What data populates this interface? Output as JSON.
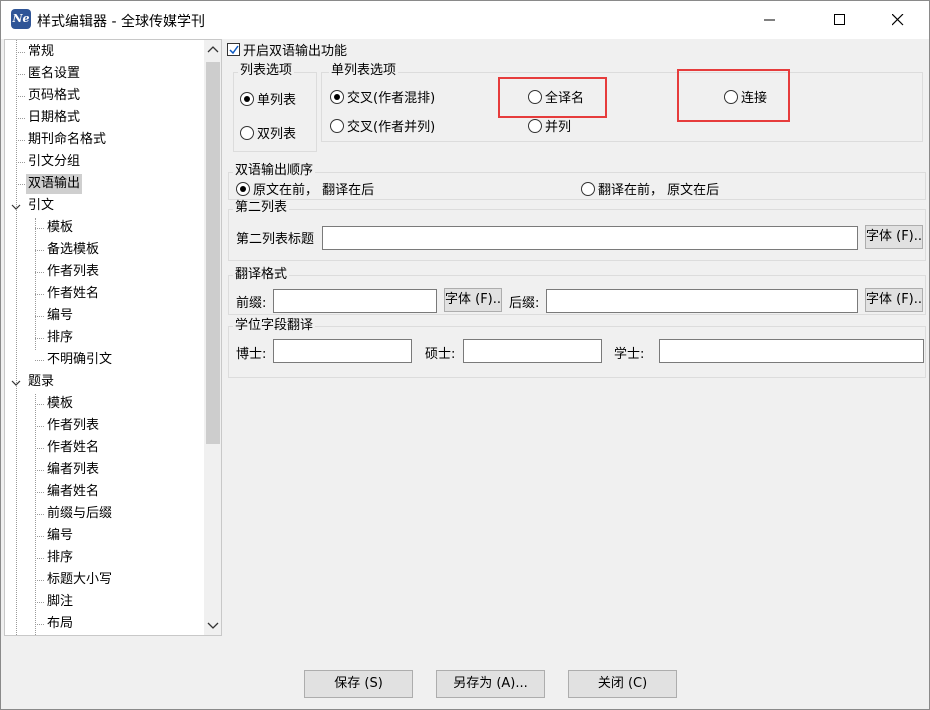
{
  "window": {
    "title": "样式编辑器 - 全球传媒学刊",
    "app_icon_text": "Ne"
  },
  "tree": {
    "items": [
      {
        "label": "常规"
      },
      {
        "label": "匿名设置"
      },
      {
        "label": "页码格式"
      },
      {
        "label": "日期格式"
      },
      {
        "label": "期刊命名格式"
      },
      {
        "label": "引文分组"
      },
      {
        "label": "双语输出",
        "selected": true
      },
      {
        "label": "引文",
        "expanded": true
      },
      {
        "label": "模板"
      },
      {
        "label": "备选模板"
      },
      {
        "label": "作者列表"
      },
      {
        "label": "作者姓名"
      },
      {
        "label": "编号"
      },
      {
        "label": "排序"
      },
      {
        "label": "不明确引文"
      },
      {
        "label": "题录",
        "expanded": true
      },
      {
        "label": "模板"
      },
      {
        "label": "作者列表"
      },
      {
        "label": "作者姓名"
      },
      {
        "label": "编者列表"
      },
      {
        "label": "编者姓名"
      },
      {
        "label": "前缀与后缀"
      },
      {
        "label": "编号"
      },
      {
        "label": "排序"
      },
      {
        "label": "标题大小写"
      },
      {
        "label": "脚注"
      },
      {
        "label": "布局"
      }
    ]
  },
  "bilingual": {
    "enable_label": "开启双语输出功能",
    "enable_checked": true,
    "list_options": {
      "legend": "列表选项",
      "single": "单列表",
      "double": "双列表",
      "selected": "single"
    },
    "single_list_options": {
      "legend": "单列表选项",
      "cross_mixed": "交叉(作者混排)",
      "cross_parallel": "交叉(作者并列)",
      "full_translated": "全译名",
      "parallel": "并列",
      "connect": "连接",
      "selected": "cross_mixed"
    },
    "order": {
      "legend": "双语输出顺序",
      "original_first": "原文在前， 翻译在后",
      "translation_first": "翻译在前， 原文在后",
      "selected": "original_first"
    },
    "second_list": {
      "legend": "第二列表",
      "title_label": "第二列表标题",
      "title_value": "",
      "font_button": "字体 (F)..",
      "font_mnemonic": "F"
    },
    "translation_format": {
      "legend": "翻译格式",
      "prefix_label": "前缀:",
      "prefix_value": "",
      "prefix_font_button": "字体 (F)..",
      "suffix_label": "后缀:",
      "suffix_value": "",
      "suffix_font_button": "字体 (F).."
    },
    "degree_translation": {
      "legend": "学位字段翻译",
      "phd_label": "博士:",
      "phd_value": "",
      "master_label": "硕士:",
      "master_value": "",
      "bachelor_label": "学士:",
      "bachelor_value": ""
    }
  },
  "footer": {
    "save": "保存 (S)",
    "save_as": "另存为 (A)...",
    "close": "关闭 (C)"
  },
  "colors": {
    "highlight": "#e63c3c",
    "selection": "#cfcfcf",
    "background": "#f0f0f0"
  }
}
